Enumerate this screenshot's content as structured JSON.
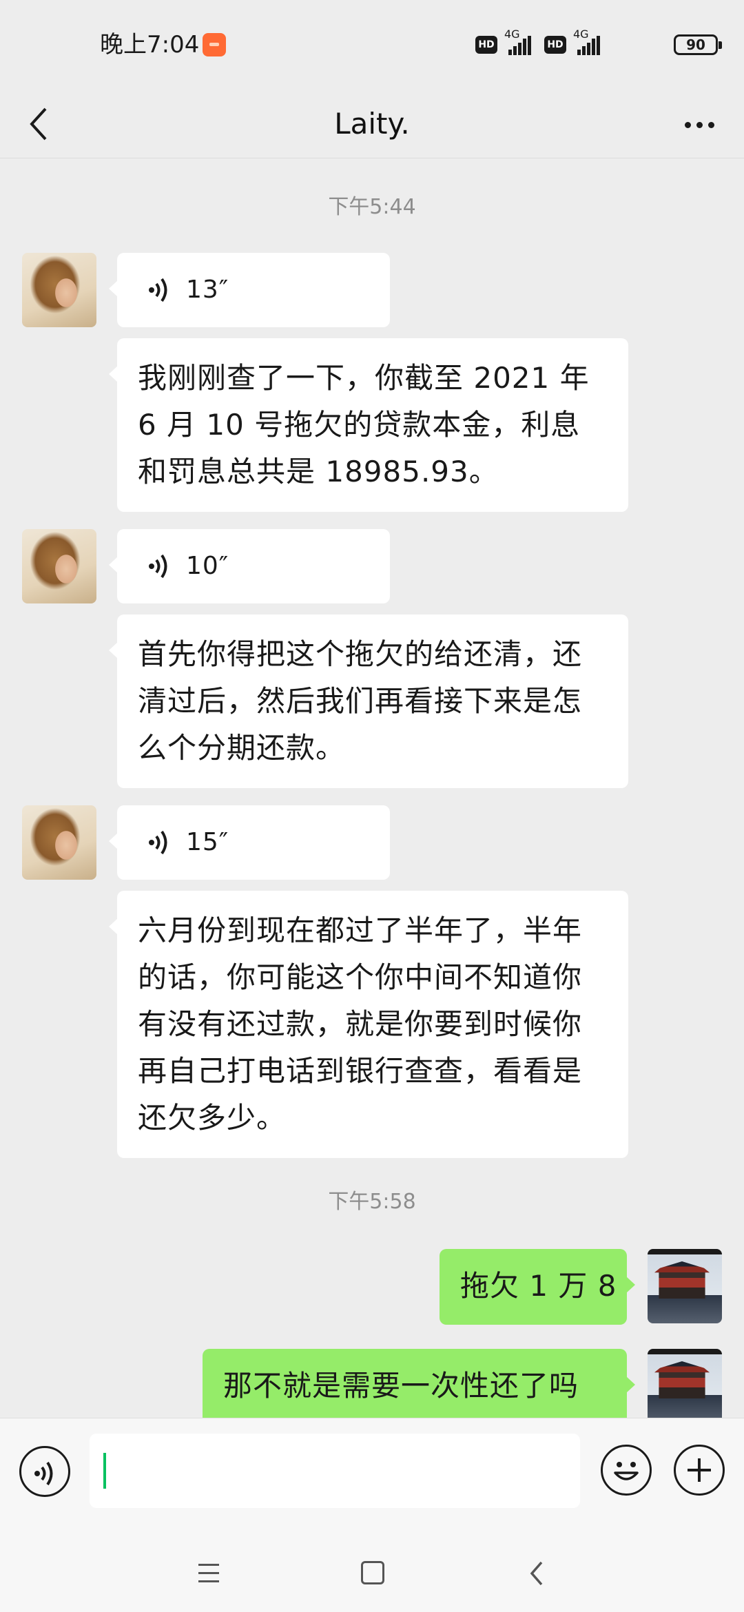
{
  "status_bar": {
    "time": "晚上7:04",
    "hd_label": "HD",
    "network_label": "4G",
    "battery": "90"
  },
  "header": {
    "title": "Laity."
  },
  "chat": {
    "timestamps": [
      "下午5:44",
      "下午5:58"
    ],
    "messages": [
      {
        "side": "left",
        "type": "voice",
        "duration": "13″"
      },
      {
        "side": "left",
        "type": "text",
        "text": "我刚刚查了一下，你截至 2021 年 6 月 10 号拖欠的贷款本金，利息和罚息总共是 18985.93。"
      },
      {
        "side": "left",
        "type": "voice",
        "duration": "10″"
      },
      {
        "side": "left",
        "type": "text",
        "text": "首先你得把这个拖欠的给还清，还清过后，然后我们再看接下来是怎么个分期还款。"
      },
      {
        "side": "left",
        "type": "voice",
        "duration": "15″"
      },
      {
        "side": "left",
        "type": "text",
        "text": "六月份到现在都过了半年了，半年的话，你可能这个你中间不知道你有没有还过款，就是你要到时候你再自己打电话到银行查查，看看是还欠多少。"
      },
      {
        "side": "right",
        "type": "text",
        "text": "拖欠 1 万 8"
      },
      {
        "side": "right",
        "type": "text",
        "text": "那不就是需要一次性还了吗"
      }
    ]
  },
  "input_bar": {
    "value": ""
  },
  "colors": {
    "background": "#ededed",
    "bubble_left": "#ffffff",
    "bubble_right": "#95ec69",
    "caret": "#07c160"
  },
  "icons": {
    "back": "chevron-left-icon",
    "more": "more-dots-icon",
    "voice": "voice-wave-icon",
    "emoji": "emoji-icon",
    "plus": "plus-icon",
    "nav_menu": "menu-icon",
    "nav_home": "home-square-icon",
    "nav_back": "back-arrow-icon"
  }
}
